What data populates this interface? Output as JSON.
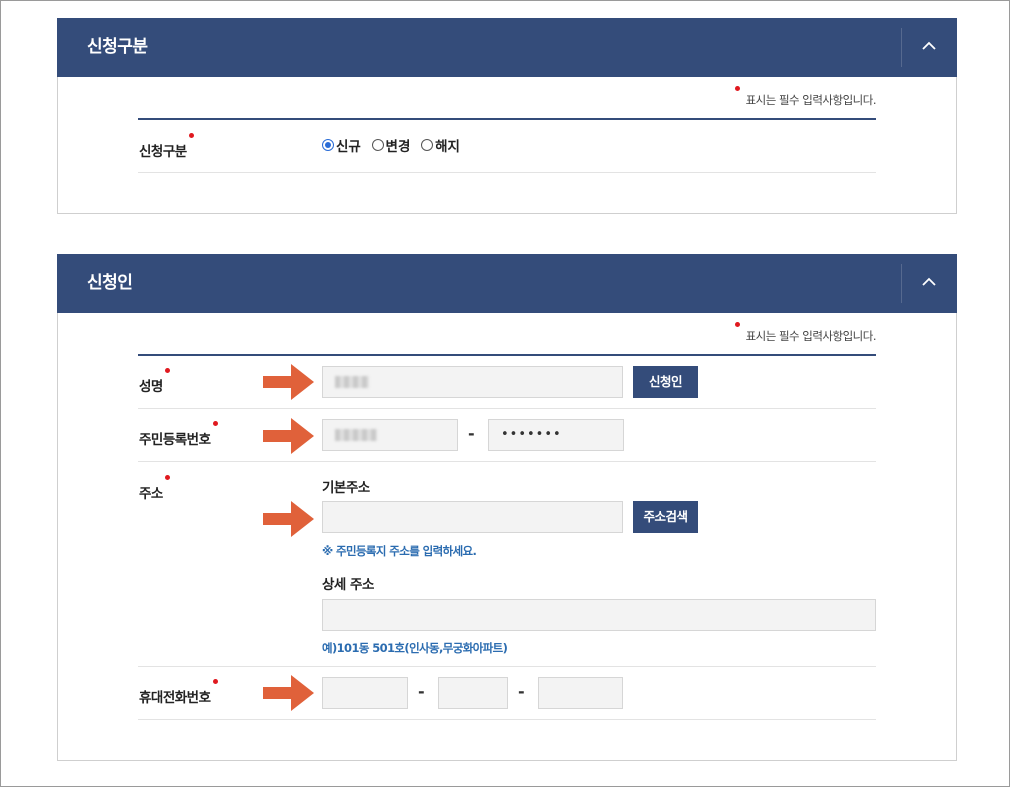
{
  "required_note": "표시는 필수 입력사항입니다.",
  "section1": {
    "title": "신청구분",
    "field_label": "신청구분",
    "radios": [
      {
        "label": "신규",
        "checked": true
      },
      {
        "label": "변경",
        "checked": false
      },
      {
        "label": "해지",
        "checked": false
      }
    ]
  },
  "section2": {
    "title": "신청인",
    "name": {
      "label": "성명",
      "button": "신청인"
    },
    "rrn": {
      "label": "주민등록번호",
      "dash": "-",
      "back_masked": "•••••••"
    },
    "address": {
      "label": "주소",
      "basic_label": "기본주소",
      "search_button": "주소검색",
      "basic_hint": "※ 주민등록지 주소를 입력하세요.",
      "detail_label": "상세 주소",
      "detail_hint": "예)101동 501호(인사동,무궁화아파트)"
    },
    "phone": {
      "label": "휴대전화번호",
      "dash1": "-",
      "dash2": "-"
    }
  },
  "colors": {
    "header": "#344c7a",
    "required": "#e0191f",
    "arrow": "#e0613a",
    "hint": "#2b6cb0"
  },
  "icons": {
    "toggle": "chevron-up-icon",
    "pointer": "arrow-right-icon"
  }
}
